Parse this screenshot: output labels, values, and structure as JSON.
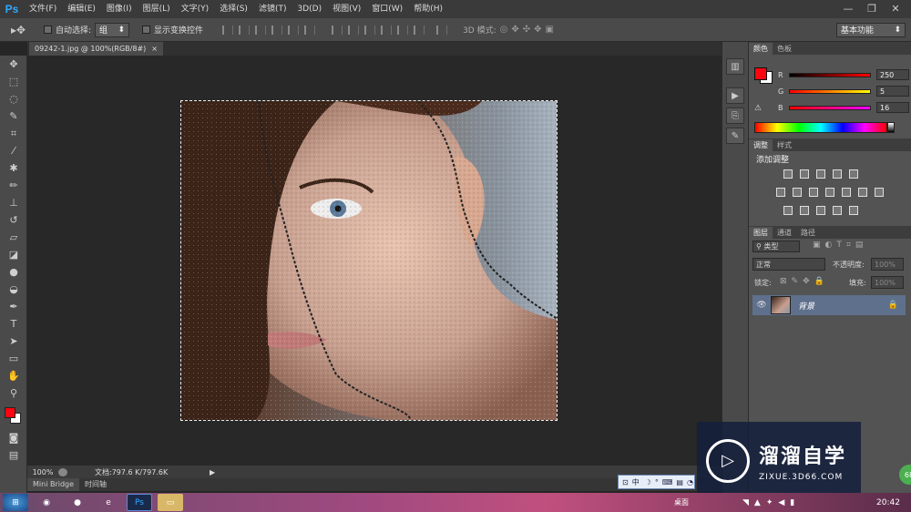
{
  "menubar": {
    "logo": "Ps",
    "items": [
      "文件(F)",
      "编辑(E)",
      "图像(I)",
      "图层(L)",
      "文字(Y)",
      "选择(S)",
      "滤镜(T)",
      "3D(D)",
      "视图(V)",
      "窗口(W)",
      "帮助(H)"
    ],
    "minimize": "—",
    "restore": "❐",
    "close": "✕"
  },
  "options": {
    "auto_select_label": "自动选择:",
    "auto_select_value": "组",
    "show_transform_label": "显示变换控件",
    "mode3d_label": "3D 模式:",
    "workspace": "基本功能"
  },
  "document": {
    "tab_title": "09242-1.jpg @ 100%(RGB/8#)",
    "tab_close": "×"
  },
  "status": {
    "zoom": "100%",
    "doc_info": "文档:797.6 K/797.6K"
  },
  "bottom_tabs": [
    "Mini Bridge",
    "时间轴"
  ],
  "color_panel": {
    "tabs": [
      "颜色",
      "色板"
    ],
    "r_label": "R",
    "r_value": "250",
    "g_label": "G",
    "g_value": "5",
    "b_label": "B",
    "b_value": "16",
    "fg_color": "#fa0510"
  },
  "adjust_panel": {
    "tabs": [
      "调整",
      "样式"
    ],
    "title": "添加调整"
  },
  "layers_panel": {
    "tabs": [
      "图层",
      "通道",
      "路径"
    ],
    "filter_label": "类型",
    "blend_mode": "正常",
    "opacity_label": "不透明度:",
    "opacity_value": "100%",
    "lock_label": "锁定:",
    "fill_label": "填充:",
    "fill_value": "100%",
    "layer_name": "背景"
  },
  "ime": {
    "label": "中"
  },
  "watermark": {
    "brand": "溜溜自学",
    "url": "ZIXUE.3D66.COM"
  },
  "taskbar": {
    "desktop_label": "桌面",
    "clock": "20:42",
    "badge": "68"
  },
  "tools": [
    "move-tool",
    "marquee-tool",
    "lasso-tool",
    "quick-select-tool",
    "crop-tool",
    "eyedropper-tool",
    "spot-heal-tool",
    "brush-tool",
    "stamp-tool",
    "history-brush-tool",
    "eraser-tool",
    "gradient-tool",
    "blur-tool",
    "dodge-tool",
    "pen-tool",
    "type-tool",
    "path-select-tool",
    "shape-tool",
    "hand-tool",
    "zoom-tool"
  ]
}
